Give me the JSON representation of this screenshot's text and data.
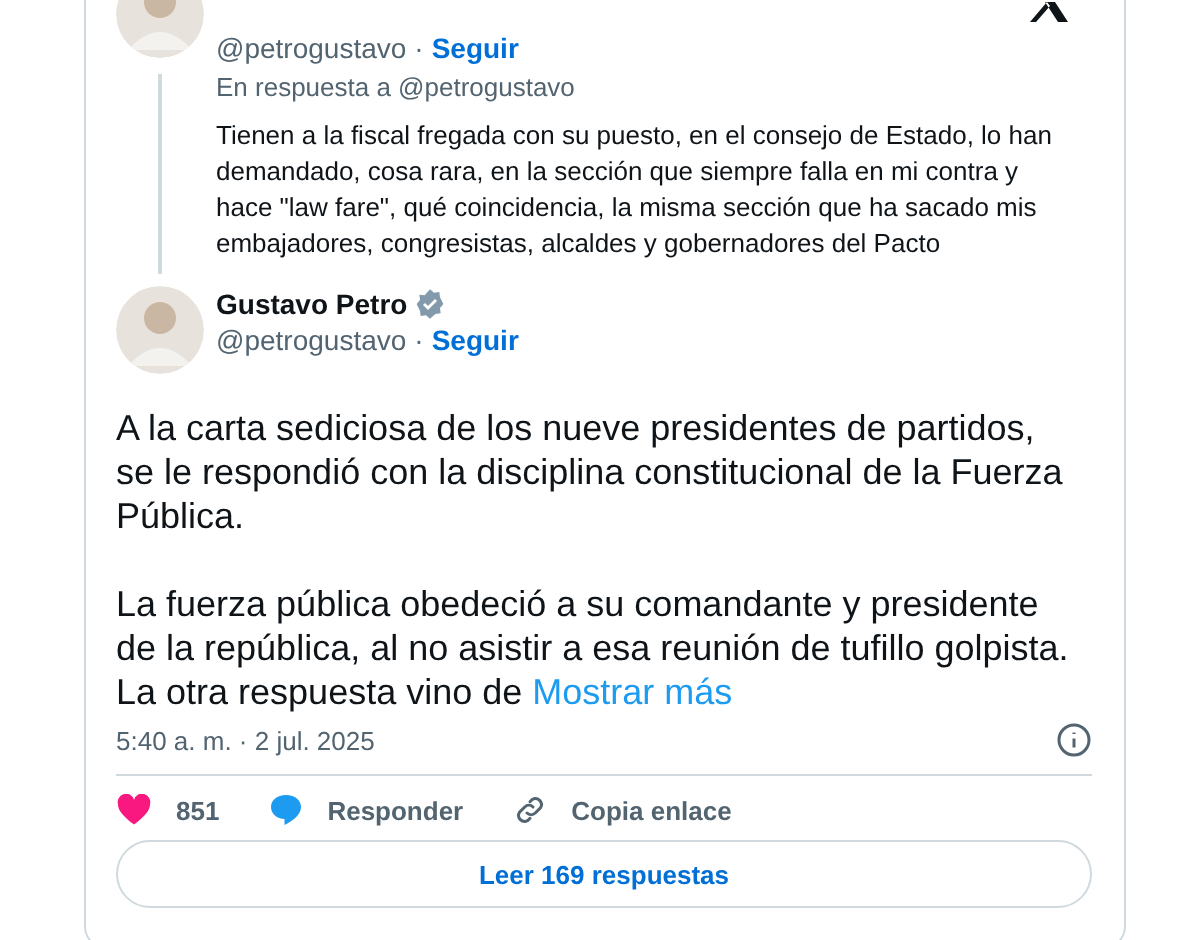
{
  "reply_to_tweet": {
    "handle": "@petrogustavo",
    "separator": "·",
    "follow": "Seguir",
    "in_reply_to": "En respuesta a @petrogustavo",
    "text": "Tienen a la fiscal fregada con su puesto, en el consejo de Estado, lo han demandado, cosa rara, en la sección que siempre falla en mi contra y hace \"law fare\", qué coincidencia, la misma sección que ha sacado mis embajadores, congresistas, alcaldes y gobernadores del Pacto"
  },
  "tweet": {
    "name": "Gustavo Petro",
    "handle": "@petrogustavo",
    "separator": "·",
    "follow": "Seguir",
    "paragraphs": [
      "A la carta sediciosa de los nueve presidentes de partidos, se le respondió con la disciplina constitucional de la Fuerza Pública.",
      "La fuerza pública obedeció a su comandante y presidente de la república, al no asistir a esa reunión de tufillo golpista. La otra respuesta vino de"
    ],
    "show_more": "Mostrar más",
    "timestamp": "5:40 a. m. · 2 jul. 2025"
  },
  "actions": [
    {
      "kind": "like",
      "label": "851"
    },
    {
      "kind": "reply",
      "label": "Responder"
    },
    {
      "kind": "copy",
      "label": "Copia enlace"
    }
  ],
  "read_replies": "Leer 169 respuestas"
}
